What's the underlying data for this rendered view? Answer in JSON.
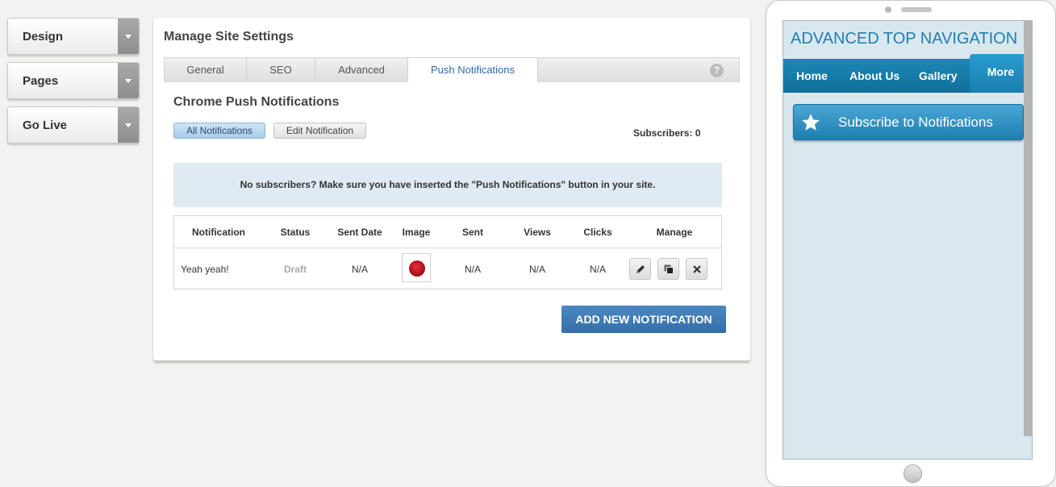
{
  "sidebar": {
    "items": [
      {
        "label": "Design"
      },
      {
        "label": "Pages"
      },
      {
        "label": "Go Live"
      }
    ]
  },
  "panel": {
    "title": "Manage Site Settings",
    "tabs": [
      {
        "label": "General",
        "active": false
      },
      {
        "label": "SEO",
        "active": false
      },
      {
        "label": "Advanced",
        "active": false
      },
      {
        "label": "Push Notifications",
        "active": true
      }
    ],
    "help_glyph": "?"
  },
  "notifications": {
    "section_title": "Chrome Push Notifications",
    "filters": {
      "all_label": "All Notifications",
      "edit_label": "Edit Notification"
    },
    "subscribers_text": "Subscribers: 0",
    "info_text": "No subscribers? Make sure you have inserted the \"Push Notifications\" button in your site.",
    "table": {
      "headers": [
        "Notification",
        "Status",
        "Sent Date",
        "Image",
        "Sent",
        "Views",
        "Clicks",
        "Manage"
      ],
      "rows": [
        {
          "notification": "Yeah yeah!",
          "status": "Draft",
          "sent_date": "N/A",
          "image_icon": "red-rose-thumbnail",
          "sent": "N/A",
          "views": "N/A",
          "clicks": "N/A"
        }
      ],
      "manage_icons": [
        "pencil-icon",
        "copy-icon",
        "close-icon"
      ]
    },
    "add_button_label": "ADD NEW NOTIFICATION"
  },
  "preview": {
    "site_title": "ADVANCED TOP NAVIGATION",
    "nav": [
      "Home",
      "About Us",
      "Gallery",
      "More"
    ],
    "subscribe_label": "Subscribe to Notifications",
    "subscribe_icon": "star-icon"
  },
  "colors": {
    "accent_blue": "#356ea8",
    "active_tab_text": "#2f6aa5",
    "info_bg": "#dfeaf2",
    "preview_nav": "#1b87b6",
    "preview_title": "#1f7fb0"
  }
}
